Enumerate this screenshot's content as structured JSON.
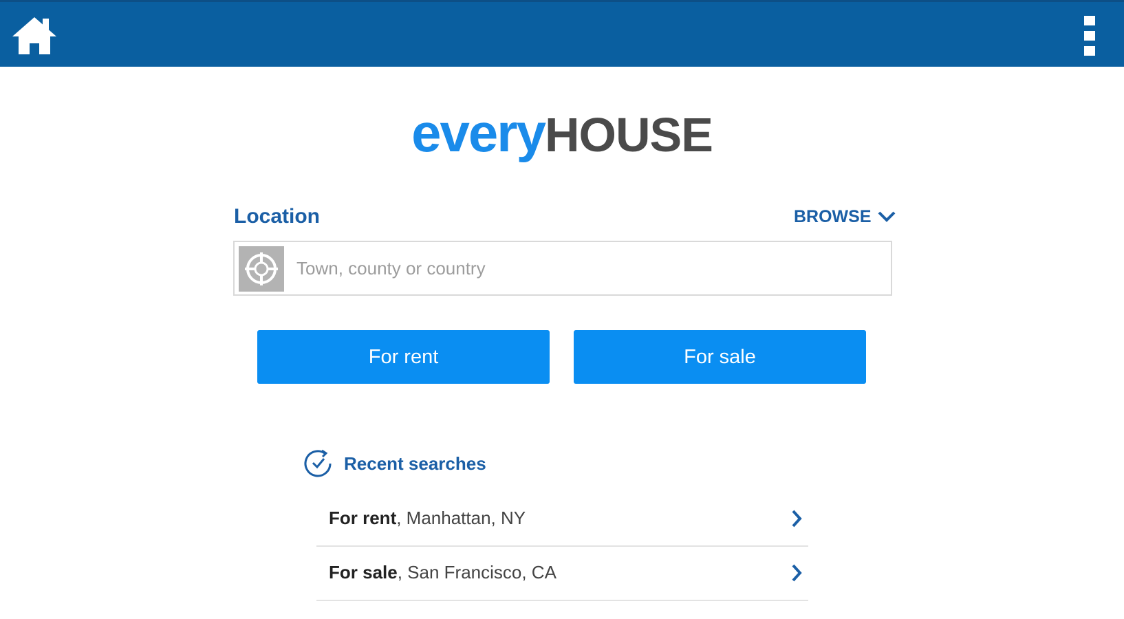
{
  "app_bar": {
    "home_icon": "home-icon",
    "overflow_icon": "overflow-menu-icon"
  },
  "logo": {
    "every": "every",
    "house": "HOUSE"
  },
  "location": {
    "label": "Location",
    "browse_label": "BROWSE",
    "browse_icon": "chevron-down-icon",
    "placeholder": "Town, county or country",
    "value": "",
    "locate_icon": "crosshair-icon"
  },
  "actions": {
    "rent_label": "For rent",
    "sale_label": "For sale"
  },
  "recent": {
    "title": "Recent searches",
    "icon": "history-clock-icon",
    "items": [
      {
        "type": "For rent",
        "place": ", Manhattan, NY"
      },
      {
        "type": "For sale",
        "place": ", San Francisco, CA"
      }
    ]
  },
  "colors": {
    "app_bar": "#0a5fa0",
    "primary_button": "#0a8ef2",
    "label_blue": "#1b5fa6",
    "logo_blue": "#1a8bea",
    "logo_gray": "#4a4a4a"
  }
}
